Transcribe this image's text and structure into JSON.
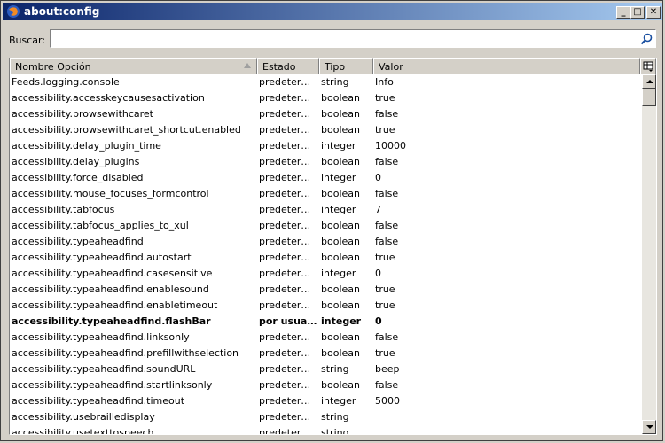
{
  "window": {
    "title": "about:config",
    "buttons": {
      "minimize": "_",
      "maximize": "□",
      "close": "✕"
    }
  },
  "search": {
    "label": "Buscar:",
    "value": "",
    "placeholder": ""
  },
  "table": {
    "columns": [
      "Nombre Opción",
      "Estado",
      "Tipo",
      "Valor"
    ],
    "rows": [
      {
        "name": "Feeds.logging.console",
        "status": "predetermin...",
        "type": "string",
        "value": "Info",
        "bold": false
      },
      {
        "name": "accessibility.accesskeycausesactivation",
        "status": "predetermin...",
        "type": "boolean",
        "value": "true",
        "bold": false
      },
      {
        "name": "accessibility.browsewithcaret",
        "status": "predetermin...",
        "type": "boolean",
        "value": "false",
        "bold": false
      },
      {
        "name": "accessibility.browsewithcaret_shortcut.enabled",
        "status": "predetermin...",
        "type": "boolean",
        "value": "true",
        "bold": false
      },
      {
        "name": "accessibility.delay_plugin_time",
        "status": "predetermin...",
        "type": "integer",
        "value": "10000",
        "bold": false
      },
      {
        "name": "accessibility.delay_plugins",
        "status": "predetermin...",
        "type": "boolean",
        "value": "false",
        "bold": false
      },
      {
        "name": "accessibility.force_disabled",
        "status": "predetermin...",
        "type": "integer",
        "value": "0",
        "bold": false
      },
      {
        "name": "accessibility.mouse_focuses_formcontrol",
        "status": "predetermin...",
        "type": "boolean",
        "value": "false",
        "bold": false
      },
      {
        "name": "accessibility.tabfocus",
        "status": "predetermin...",
        "type": "integer",
        "value": "7",
        "bold": false
      },
      {
        "name": "accessibility.tabfocus_applies_to_xul",
        "status": "predetermin...",
        "type": "boolean",
        "value": "false",
        "bold": false
      },
      {
        "name": "accessibility.typeaheadfind",
        "status": "predetermin...",
        "type": "boolean",
        "value": "false",
        "bold": false
      },
      {
        "name": "accessibility.typeaheadfind.autostart",
        "status": "predetermin...",
        "type": "boolean",
        "value": "true",
        "bold": false
      },
      {
        "name": "accessibility.typeaheadfind.casesensitive",
        "status": "predetermin...",
        "type": "integer",
        "value": "0",
        "bold": false
      },
      {
        "name": "accessibility.typeaheadfind.enablesound",
        "status": "predetermin...",
        "type": "boolean",
        "value": "true",
        "bold": false
      },
      {
        "name": "accessibility.typeaheadfind.enabletimeout",
        "status": "predetermin...",
        "type": "boolean",
        "value": "true",
        "bold": false
      },
      {
        "name": "accessibility.typeaheadfind.flashBar",
        "status": "por usuario",
        "type": "integer",
        "value": "0",
        "bold": true
      },
      {
        "name": "accessibility.typeaheadfind.linksonly",
        "status": "predetermin...",
        "type": "boolean",
        "value": "false",
        "bold": false
      },
      {
        "name": "accessibility.typeaheadfind.prefillwithselection",
        "status": "predetermin...",
        "type": "boolean",
        "value": "true",
        "bold": false
      },
      {
        "name": "accessibility.typeaheadfind.soundURL",
        "status": "predetermin...",
        "type": "string",
        "value": "beep",
        "bold": false
      },
      {
        "name": "accessibility.typeaheadfind.startlinksonly",
        "status": "predetermin...",
        "type": "boolean",
        "value": "false",
        "bold": false
      },
      {
        "name": "accessibility.typeaheadfind.timeout",
        "status": "predetermin...",
        "type": "integer",
        "value": "5000",
        "bold": false
      },
      {
        "name": "accessibility.usebrailledisplay",
        "status": "predetermin...",
        "type": "string",
        "value": "",
        "bold": false
      },
      {
        "name": "accessibility.usetexttospeech",
        "status": "predetermin...",
        "type": "string",
        "value": "",
        "bold": false
      }
    ]
  },
  "colors": {
    "titlebar_start": "#0a246a",
    "titlebar_end": "#a6caf0",
    "chrome": "#d4d0c8"
  },
  "icons": [
    "firefox-icon",
    "search-icon",
    "column-picker-icon",
    "sort-ascending-icon"
  ]
}
